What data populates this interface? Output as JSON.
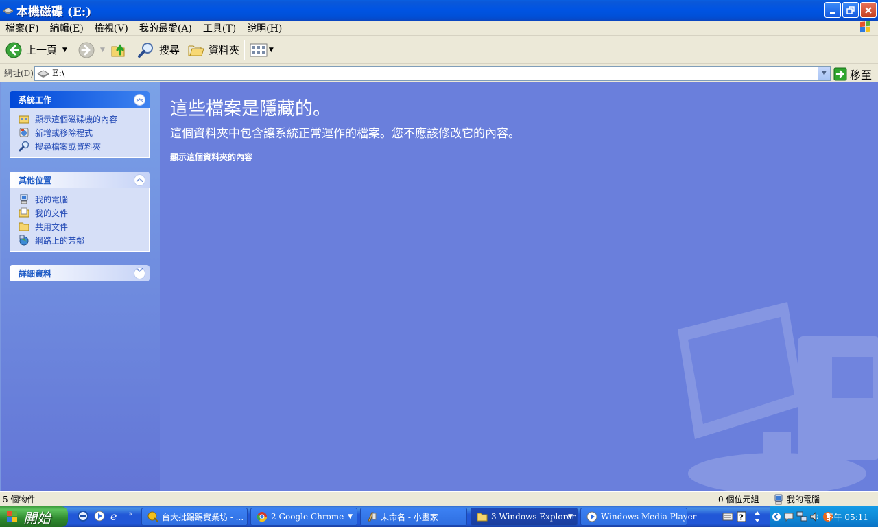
{
  "window": {
    "title": "本機磁碟 (E:)"
  },
  "menu": [
    "檔案(F)",
    "編輯(E)",
    "檢視(V)",
    "我的最愛(A)",
    "工具(T)",
    "說明(H)"
  ],
  "toolbar": {
    "back_label": "上一頁",
    "search_label": "搜尋",
    "folders_label": "資料夾"
  },
  "address": {
    "label": "網址(D)",
    "value": "E:\\",
    "go_label": "移至"
  },
  "sidebar": {
    "system_tasks": {
      "title": "系統工作",
      "items": [
        "顯示這個磁碟機的內容",
        "新增或移除程式",
        "搜尋檔案或資料夾"
      ]
    },
    "other_places": {
      "title": "其他位置",
      "items": [
        "我的電腦",
        "我的文件",
        "共用文件",
        "網路上的芳鄰"
      ]
    },
    "details": {
      "title": "詳細資料"
    }
  },
  "main": {
    "title": "這些檔案是隱藏的。",
    "description": "這個資料夾中包含讓系統正常運作的檔案。您不應該修改它的內容。",
    "link": "顯示這個資料夾的內容"
  },
  "status": {
    "objects": "5 個物件",
    "size": "0 個位元組",
    "location": "我的電腦"
  },
  "taskbar": {
    "start_label": "開始",
    "tasks": [
      "台大批踢踢實業坊 - ...",
      "2 Google Chrome",
      "未命名 - 小畫家",
      "3 Windows Explorer",
      "Windows Media Player"
    ],
    "clock": "下午 05:11"
  },
  "colors": {
    "title_bar": "#0054e3",
    "main_bg": "#6a7fdc",
    "link": "#2249b5",
    "start_green": "#3c9a3c"
  }
}
